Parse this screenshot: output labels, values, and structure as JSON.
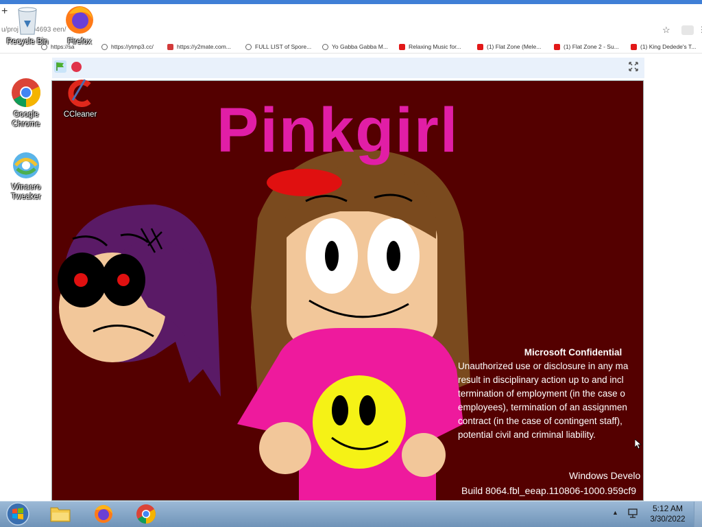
{
  "browser": {
    "new_tab": "+",
    "url": "u/proj        65394693      een/",
    "bookmarks": [
      {
        "label": "https://sa",
        "icon": "globe-icon"
      },
      {
        "label": "https://ytmp3.cc/",
        "icon": "globe-icon"
      },
      {
        "label": "https://y2mate.com...",
        "icon": "save-icon"
      },
      {
        "label": "FULL LIST of Spore...",
        "icon": "globe-icon"
      },
      {
        "label": "Yo Gabba Gabba M...",
        "icon": "globe-icon"
      },
      {
        "label": "Relaxing Music for...",
        "icon": "youtube-icon"
      },
      {
        "label": "(1) Flat Zone (Mele...",
        "icon": "youtube-icon"
      },
      {
        "label": "(1) Flat Zone 2 - Su...",
        "icon": "youtube-icon"
      },
      {
        "label": "(1) King Dedede's T...",
        "icon": "youtube-icon"
      }
    ]
  },
  "stage": {
    "title": "Pinkgirl",
    "background_color": "#540000",
    "title_color": "#e11ea6"
  },
  "desktop": {
    "icons": [
      {
        "label": "Recycle Bin"
      },
      {
        "label": "Firefox"
      },
      {
        "label": "Google Chrome"
      },
      {
        "label": "CCleaner"
      },
      {
        "label": "Winaero Tweaker"
      }
    ]
  },
  "watermark": {
    "title": "Microsoft Confidential",
    "lines": [
      "Unauthorized use or disclosure in any ma",
      "result in disciplinary action up to and incl",
      "termination of employment (in the case o",
      "employees), termination of an assignmen",
      "contract (in the case of contingent staff),",
      "potential civil and criminal liability."
    ],
    "windows": "Windows Develo",
    "build": "Build 8064.fbl_eeap.110806-1000.959cf9"
  },
  "taskbar": {
    "time": "5:12 AM",
    "date": "3/30/2022",
    "tray_arrow": "▲"
  }
}
